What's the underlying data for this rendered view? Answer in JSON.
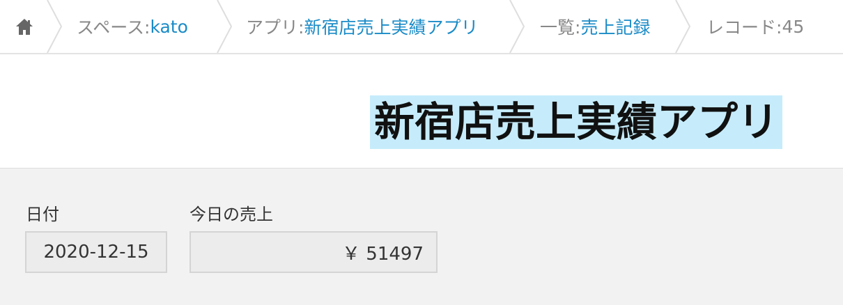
{
  "breadcrumb": {
    "home_icon": "home-icon",
    "space": {
      "prefix": "スペース: ",
      "value": "kato"
    },
    "app": {
      "prefix": "アプリ: ",
      "value": "新宿店売上実績アプリ"
    },
    "view": {
      "prefix": "一覧: ",
      "value": "売上記録"
    },
    "record": {
      "prefix": "レコード: ",
      "value": "45"
    }
  },
  "title": "新宿店売上実績アプリ",
  "fields": {
    "date": {
      "label": "日付",
      "value": "2020-12-15"
    },
    "sales": {
      "label": "今日の売上",
      "value": "￥ 51497"
    }
  },
  "colors": {
    "link": "#1a8bc7",
    "title_highlight": "#c6ecfb",
    "form_background": "#f2f2f2"
  }
}
